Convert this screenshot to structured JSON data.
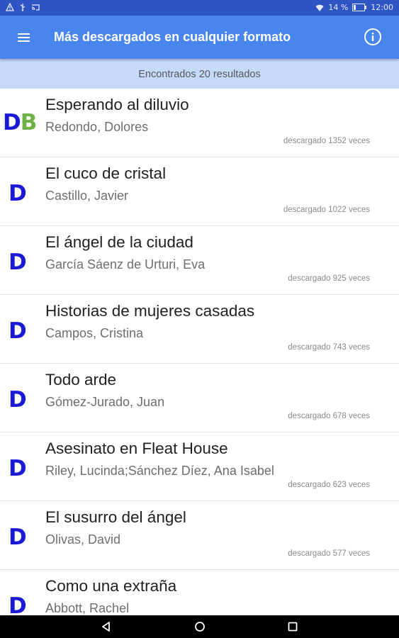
{
  "status_bar": {
    "left_icons": [
      "warning-icon",
      "usb-icon",
      "cast-icon"
    ],
    "battery": "14 %",
    "time": "12:00"
  },
  "app_bar": {
    "title": "Más descargados en cualquier formato",
    "menu_icon": "hamburger-menu-icon",
    "info_icon": "info-icon"
  },
  "results_text": "Encontrados 20 resultados",
  "books": [
    {
      "title": "Esperando al diluvio",
      "author": "Redondo, Dolores",
      "count": "descargado 1352 veces",
      "formats": [
        "D",
        "B"
      ]
    },
    {
      "title": "El cuco de cristal",
      "author": "Castillo, Javier",
      "count": "descargado 1022 veces",
      "formats": [
        "D"
      ]
    },
    {
      "title": "El ángel de la ciudad",
      "author": "García Sáenz de Urturi, Eva",
      "count": "descargado 925 veces",
      "formats": [
        "D"
      ]
    },
    {
      "title": "Historias de mujeres casadas",
      "author": "Campos, Cristina",
      "count": "descargado 743 veces",
      "formats": [
        "D"
      ]
    },
    {
      "title": "Todo arde",
      "author": "Gómez-Jurado, Juan",
      "count": "descargado 678 veces",
      "formats": [
        "D"
      ]
    },
    {
      "title": "Asesinato en Fleat House",
      "author": "Riley, Lucinda;Sánchez Díez, Ana Isabel",
      "count": "descargado 623 veces",
      "formats": [
        "D"
      ]
    },
    {
      "title": "El susurro del ángel",
      "author": "Olivas, David",
      "count": "descargado 577 veces",
      "formats": [
        "D"
      ]
    },
    {
      "title": "Como una extraña",
      "author": "Abbott, Rachel",
      "count": "",
      "formats": [
        "D"
      ]
    }
  ],
  "colors": {
    "app_bar": "#4885ed",
    "status_bar": "#2f55c5",
    "results_bar": "#c5d9fb",
    "format_d": "#1a1ad6",
    "format_b": "#6fb248"
  },
  "nav": [
    "back-icon",
    "home-icon",
    "recents-icon"
  ]
}
